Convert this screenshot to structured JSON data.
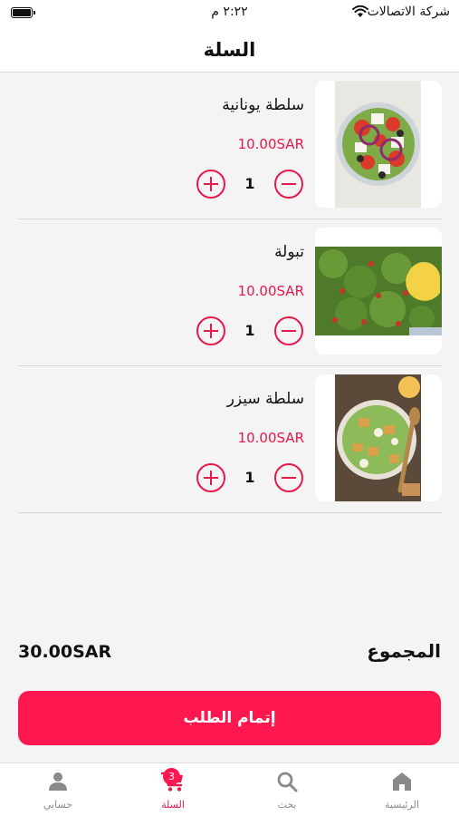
{
  "status_bar": {
    "carrier": "شركة الاتصالات",
    "time": "٢:٢٢ م"
  },
  "header": {
    "title": "السلة"
  },
  "cart": {
    "items": [
      {
        "name": "سلطة يونانية",
        "price": "10.00SAR",
        "quantity": "1",
        "image": "greek-salad"
      },
      {
        "name": "تبولة",
        "price": "10.00SAR",
        "quantity": "1",
        "image": "tabbouleh"
      },
      {
        "name": "سلطة سيزر",
        "price": "10.00SAR",
        "quantity": "1",
        "image": "caesar-salad"
      }
    ]
  },
  "summary": {
    "total_label": "المجموع",
    "total_value": "30.00SAR",
    "checkout_label": "إتمام الطلب"
  },
  "tab_bar": {
    "tabs": [
      {
        "label": "الرئيسية",
        "icon": "home-icon"
      },
      {
        "label": "بحث",
        "icon": "search-icon"
      },
      {
        "label": "السلة",
        "icon": "cart-icon",
        "badge": "3",
        "active": true
      },
      {
        "label": "حسابي",
        "icon": "user-icon"
      }
    ]
  },
  "colors": {
    "accent": "#ff1850",
    "price": "#e8184a",
    "inactive_tab": "#8a8a8a"
  }
}
